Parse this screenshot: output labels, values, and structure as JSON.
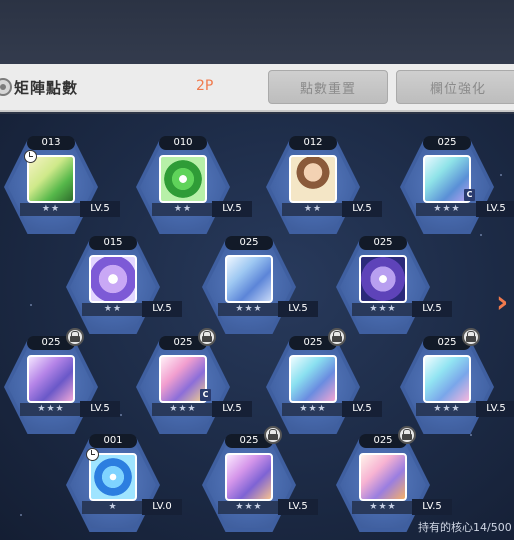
{
  "header": {
    "title": "矩陣點數",
    "points": "2P",
    "reset_label": "點數重置",
    "enhance_label": "欄位強化"
  },
  "cores": [
    {
      "num": "013",
      "stars": "★★",
      "lv": "LV.5",
      "locked": false,
      "clock": true,
      "c": false,
      "art": "green-arrow"
    },
    {
      "num": "010",
      "stars": "★★",
      "lv": "LV.5",
      "locked": false,
      "clock": false,
      "c": false,
      "art": "green-eye"
    },
    {
      "num": "012",
      "stars": "★★",
      "lv": "LV.5",
      "locked": false,
      "clock": false,
      "c": false,
      "art": "character"
    },
    {
      "num": "025",
      "stars": "★★★",
      "lv": "LV.5",
      "locked": false,
      "clock": false,
      "c": true,
      "art": "crystal-teal"
    },
    {
      "num": "015",
      "stars": "★★",
      "lv": "LV.5",
      "locked": false,
      "clock": false,
      "c": false,
      "art": "purple-star"
    },
    {
      "num": "025",
      "stars": "★★★",
      "lv": "LV.5",
      "locked": false,
      "clock": false,
      "c": false,
      "art": "blue-crystal"
    },
    {
      "num": "025",
      "stars": "★★★",
      "lv": "LV.5",
      "locked": false,
      "clock": false,
      "c": false,
      "art": "purple-burst"
    },
    {
      "num": "025",
      "stars": "★★★",
      "lv": "LV.5",
      "locked": true,
      "clock": false,
      "c": false,
      "art": "purple-y"
    },
    {
      "num": "025",
      "stars": "★★★",
      "lv": "LV.5",
      "locked": true,
      "clock": false,
      "c": true,
      "art": "pink-y"
    },
    {
      "num": "025",
      "stars": "★★★",
      "lv": "LV.5",
      "locked": true,
      "clock": false,
      "c": false,
      "art": "teal-y"
    },
    {
      "num": "025",
      "stars": "★★★",
      "lv": "LV.5",
      "locked": true,
      "clock": false,
      "c": false,
      "art": "cyan-y"
    },
    {
      "num": "001",
      "stars": "★",
      "lv": "LV.0",
      "locked": false,
      "clock": true,
      "c": false,
      "art": "blue-target"
    },
    {
      "num": "025",
      "stars": "★★★",
      "lv": "LV.5",
      "locked": true,
      "clock": false,
      "c": false,
      "art": "purple-pink"
    },
    {
      "num": "025",
      "stars": "★★★",
      "lv": "LV.5",
      "locked": true,
      "clock": false,
      "c": false,
      "art": "pink-orange-y"
    }
  ],
  "c_badge": "C",
  "next_arrow": "›",
  "footer": {
    "owned_cores": "持有的核心14/500"
  },
  "colors": {
    "accent": "#f07a4d",
    "hex_fill": "#4566a8",
    "board_bg": "#1c2a45"
  },
  "icons": {
    "lock": "lock-icon",
    "clock": "clock-icon",
    "target": "target-icon",
    "next": "chevron-right-icon"
  }
}
